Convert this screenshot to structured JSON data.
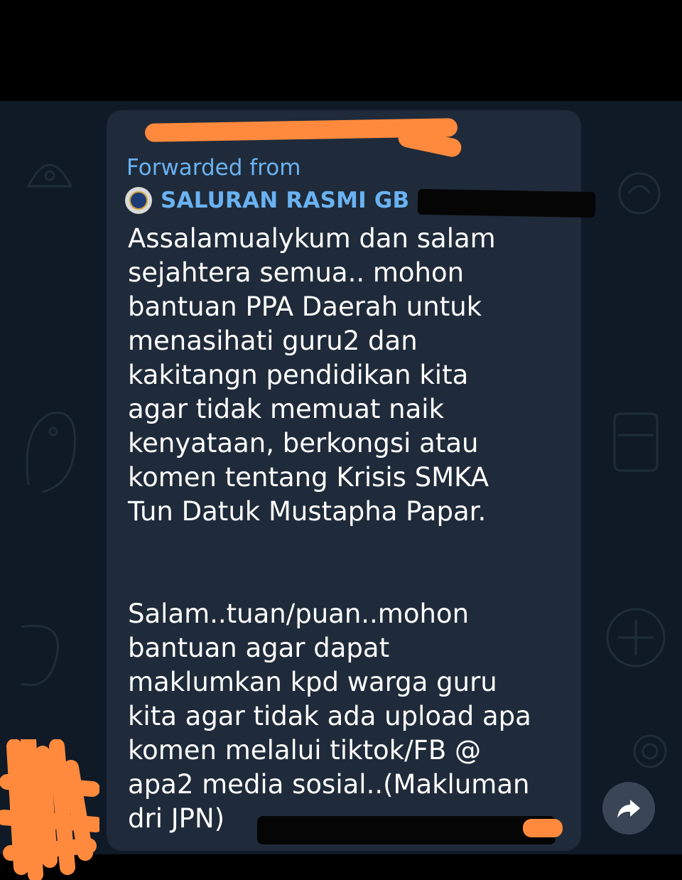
{
  "forward_header": {
    "label": "Forwarded from",
    "channel_name": "SALURAN RASMI GB ("
  },
  "message": {
    "paragraph_1": "Assalamualykum dan salam\nsejahtera semua.. mohon\nbantuan PPA Daerah untuk\nmenasihati guru2 dan\nkakitangn pendidikan kita\nagar tidak memuat naik\nkenyataan, berkongsi atau\nkomen tentang Krisis SMKA\nTun Datuk Mustapha Papar.",
    "paragraph_2": "Salam..tuan/puan..mohon\nbantuan agar dapat\nmaklumkan kpd warga guru\nkita agar tidak ada upload apa\nkomen melalui tiktok/FB @\napa2 media sosial..(Makluman\ndri JPN)"
  },
  "icons": {
    "share": "share-arrow-icon",
    "channel_avatar": "channel-logo-icon"
  },
  "colors": {
    "link_blue": "#6ab2f2",
    "bubble": "#1f2b3a",
    "background": "#0f1a26",
    "redaction_orange": "#ff8a3d"
  }
}
